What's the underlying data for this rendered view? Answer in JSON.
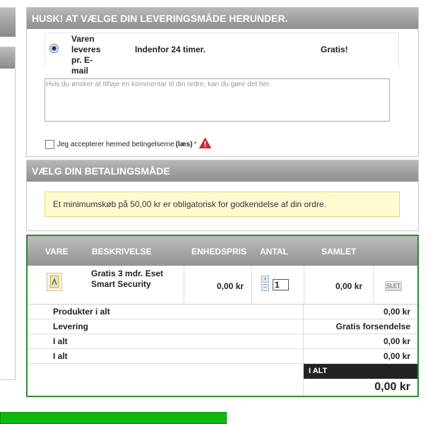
{
  "delivery": {
    "title": "HUSK! AT VÆLGE DIN LEVERINGSMÅDE HERUNDER.",
    "option": {
      "name": "Varen leveres pr. E-mail",
      "time": "Indenfor 24 timer.",
      "price": "Gratis!",
      "selected": true
    },
    "comment_placeholder": "Hvis du ønsker at tilføje en kommentar til din ordre, kan du gøre det her.",
    "terms": {
      "prefix": "Jeg accepterer hermed betingelserne",
      "link": "(læs)",
      "required": "*"
    }
  },
  "payment": {
    "title": "VÆLG DIN BETALINGSMÅDE",
    "notice": "Et minimumskøb på 50,00 kr er obligatorisk for godkendelse af din ordre."
  },
  "cart": {
    "headers": [
      "VARE",
      "BESKRIVELSE",
      "ENHEDSPRIS",
      "ANTAL",
      "SAMLET"
    ],
    "item": {
      "description": "Gratis 3 mdr. Eset Smart Security",
      "unit_price": "0,00 kr",
      "qty": "1",
      "total": "0,00 kr",
      "delete_label": "SLET"
    },
    "summary": [
      {
        "label": "Produkter i alt",
        "value": "0,00 kr"
      },
      {
        "label": "Levering",
        "value": "Gratis forsendelse"
      },
      {
        "label": "I alt",
        "value": "0,00 kr"
      },
      {
        "label": "I alt",
        "value": "0,00 kr"
      }
    ],
    "grand_total_label": "I ALT",
    "grand_total": "0,00 kr"
  },
  "colors": {
    "panel_header": "#9e9e9e",
    "cart_border": "#2e8b2e",
    "notice_bg": "#fffbd0",
    "green_bar": "#0dbb0d",
    "total_label_bg": "#222222"
  }
}
